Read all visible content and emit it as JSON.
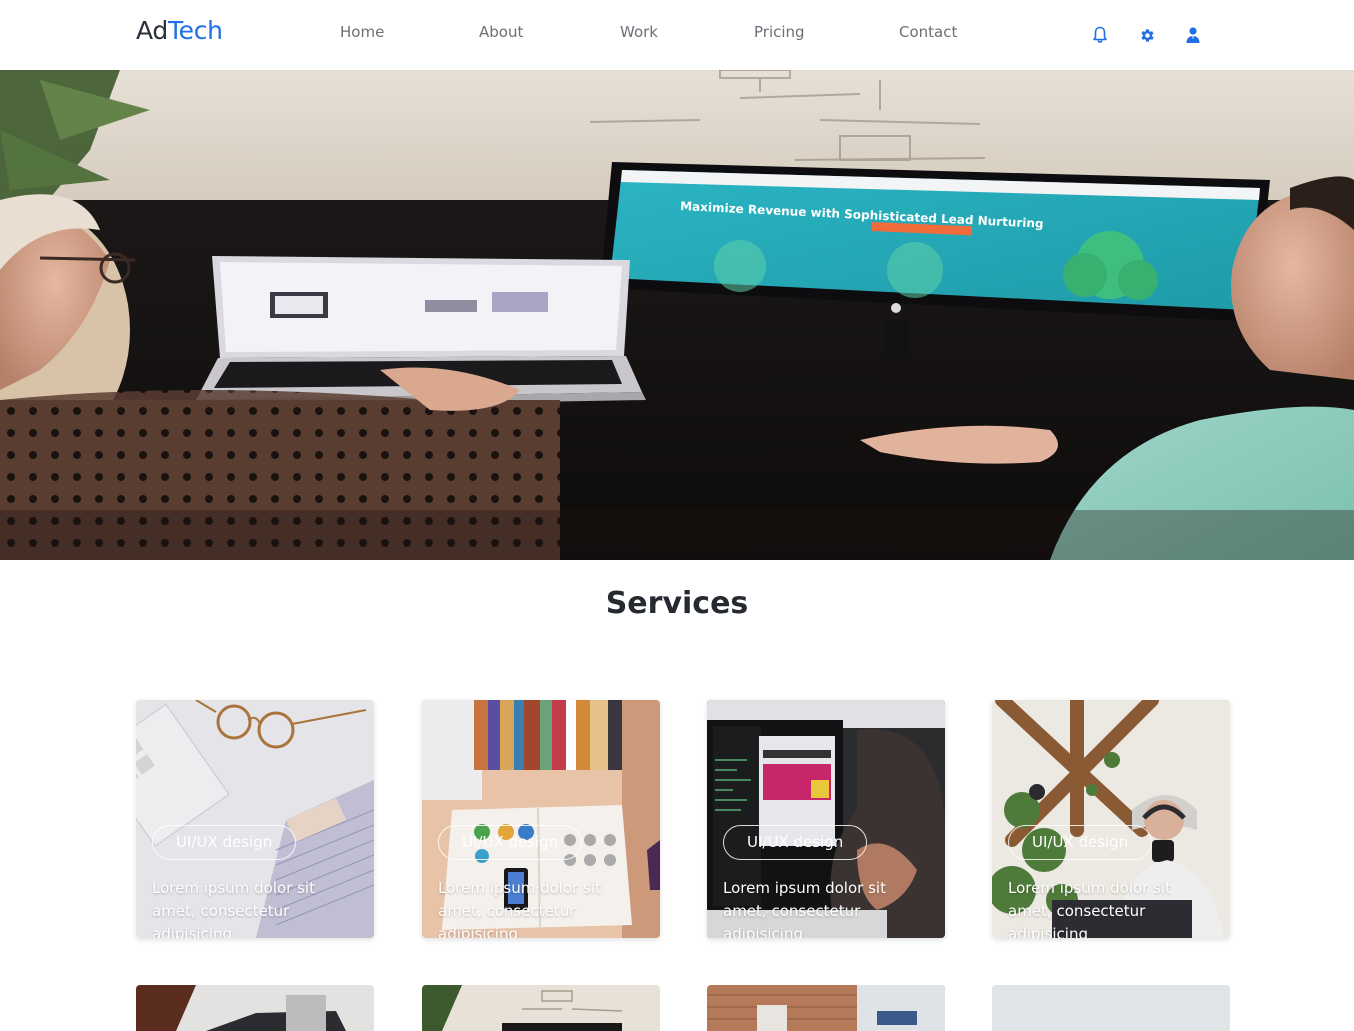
{
  "brand": {
    "part1": "Ad",
    "part2": "Tech"
  },
  "nav": {
    "home": "Home",
    "about": "About",
    "work": "Work",
    "pricing": "Pricing",
    "contact": "Contact"
  },
  "header_icons": [
    "bell-icon",
    "gear-icon",
    "user-icon"
  ],
  "colors": {
    "accent": "#1f6fe5",
    "title": "#252a31",
    "nav_text": "#6b6f76"
  },
  "hero": {
    "monitor_headline": "Maximize Revenue with Sophisticated Lead Nurturing"
  },
  "services": {
    "title": "Services",
    "cards": [
      {
        "tag": "UI/UX design",
        "text": "Lorem ipsum dolor sit amet, consectetur adipisicing"
      },
      {
        "tag": "UI/UX design",
        "text": "Lorem ipsum dolor sit amet, consectetur adipisicing"
      },
      {
        "tag": "UI/UX design",
        "text": "Lorem ipsum dolor sit amet, consectetur adipisicing"
      },
      {
        "tag": "UI/UX design",
        "text": "Lorem ipsum dolor sit amet, consectetur adipisicing"
      }
    ]
  }
}
